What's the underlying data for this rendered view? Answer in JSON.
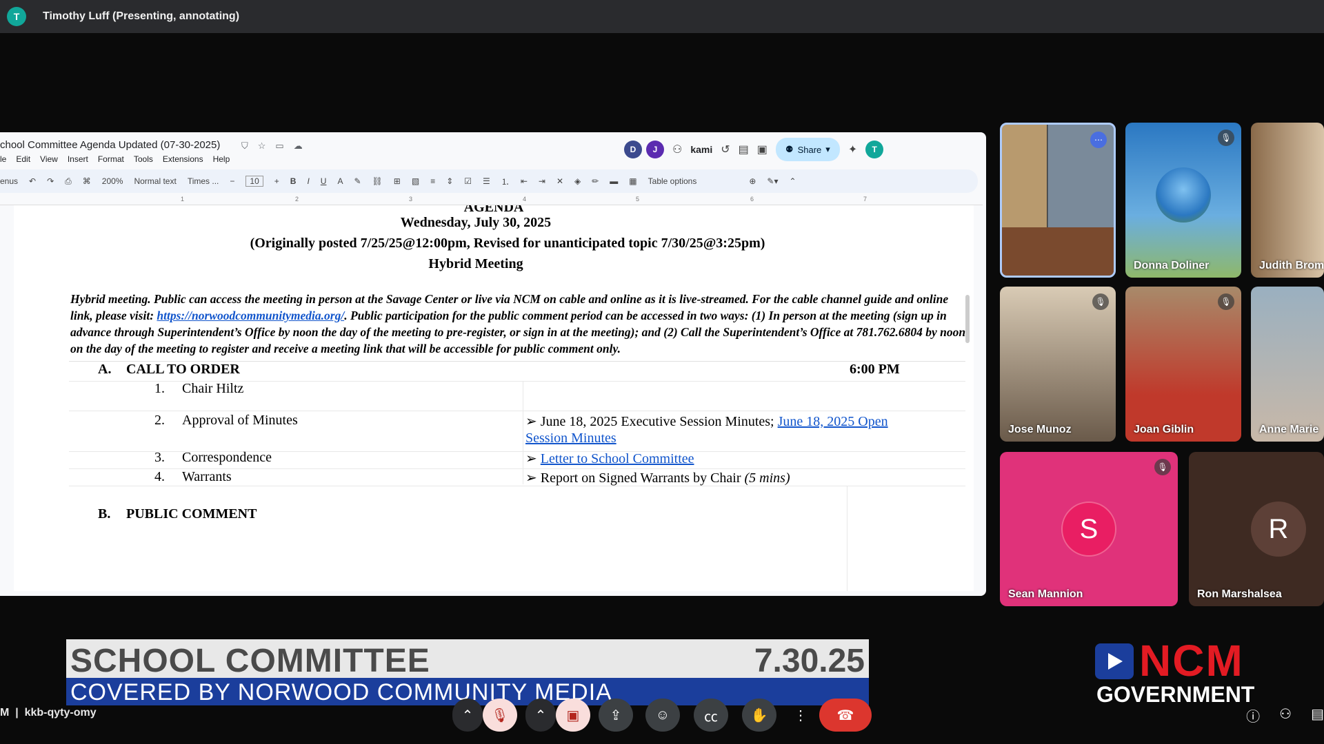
{
  "presenter": {
    "initial": "T",
    "label": "Timothy Luff (Presenting, annotating)"
  },
  "docs": {
    "title": "chool Committee Agenda Updated (07-30-2025)",
    "menu": [
      "le",
      "Edit",
      "View",
      "Insert",
      "Format",
      "Tools",
      "Extensions",
      "Help"
    ],
    "collaborators": [
      "D",
      "J"
    ],
    "kami_label": "kami",
    "share_label": "Share",
    "user_initial": "T",
    "toolbar": {
      "menus": "enus",
      "zoom": "200%",
      "style": "Normal text",
      "font": "Times ...",
      "size": "10",
      "table_options": "Table options"
    },
    "ruler_ticks": [
      "1",
      "2",
      "3",
      "4",
      "5",
      "6",
      "7"
    ]
  },
  "agenda": {
    "heading": "AGENDA",
    "date": "Wednesday, July 30, 2025",
    "posted": "(Originally posted 7/25/25@12:00pm,  Revised for unanticipated topic 7/30/25@3:25pm)",
    "meeting_type": "Hybrid Meeting",
    "intro_before_link": "Hybrid meeting. Public can access the meeting in person at the Savage Center or live via NCM on  cable and online as it is live-streamed. For the cable channel guide and online link, please visit: ",
    "intro_link": "https://norwoodcommunitymedia.org/",
    "intro_after_link": ". Public participation for the public comment period can be accessed in two ways: (1) In person at the meeting (sign up in advance through Superintendent’s Office by noon the day of the meeting to pre-register, or sign in at the meeting); and (2) Call the Superintendent’s Office at 781.762.6804 by noon on the day of the meeting to register and receive a meeting link that will be accessible for public comment only.",
    "section_a_letter": "A.",
    "section_a": "CALL TO ORDER",
    "section_a_time": "6:00 PM",
    "items": [
      {
        "num": "1.",
        "label": "Chair Hiltz"
      },
      {
        "num": "2.",
        "label": "Approval of Minutes"
      },
      {
        "num": "3.",
        "label": "Correspondence"
      },
      {
        "num": "4.",
        "label": "Warrants"
      }
    ],
    "minutes_text": "➢ June 18, 2025 Executive Session Minutes; ",
    "minutes_link_1": "June 18, 2025 Open",
    "minutes_link_2": "Session Minutes",
    "correspondence_arrow": "➢ ",
    "correspondence_link": "Letter to School Committee",
    "warrants_text": "➢ Report on Signed Warrants by Chair ",
    "warrants_time": "(5 mins)",
    "section_b_letter": "B.",
    "section_b": "PUBLIC COMMENT"
  },
  "participants": [
    {
      "name": "",
      "muted": false
    },
    {
      "name": "Donna Doliner",
      "muted": true
    },
    {
      "name": "Judith Brom",
      "muted": false
    },
    {
      "name": "Jose Munoz",
      "muted": true
    },
    {
      "name": "Joan Giblin",
      "muted": true
    },
    {
      "name": "Anne Marie",
      "muted": false
    },
    {
      "name": "Sean Mannion",
      "initial": "S",
      "muted": true
    },
    {
      "name": "Ron Marshalsea",
      "initial": "R",
      "muted": false
    }
  ],
  "lower_third": {
    "title": "SCHOOL COMMITTEE",
    "date": "7.30.25",
    "subtitle": "COVERED BY NORWOOD COMMUNITY MEDIA"
  },
  "logo": {
    "brand": "NCM",
    "sub": "GOVERNMENT"
  },
  "meet": {
    "code_prefix": "M",
    "code": "kkb-qyty-omy"
  },
  "colors": {
    "lower_third_blue": "#1b3e9c",
    "ncm_red": "#e31b23",
    "sean_tile": "#e0327a",
    "ron_avatar": "#5d4037"
  }
}
